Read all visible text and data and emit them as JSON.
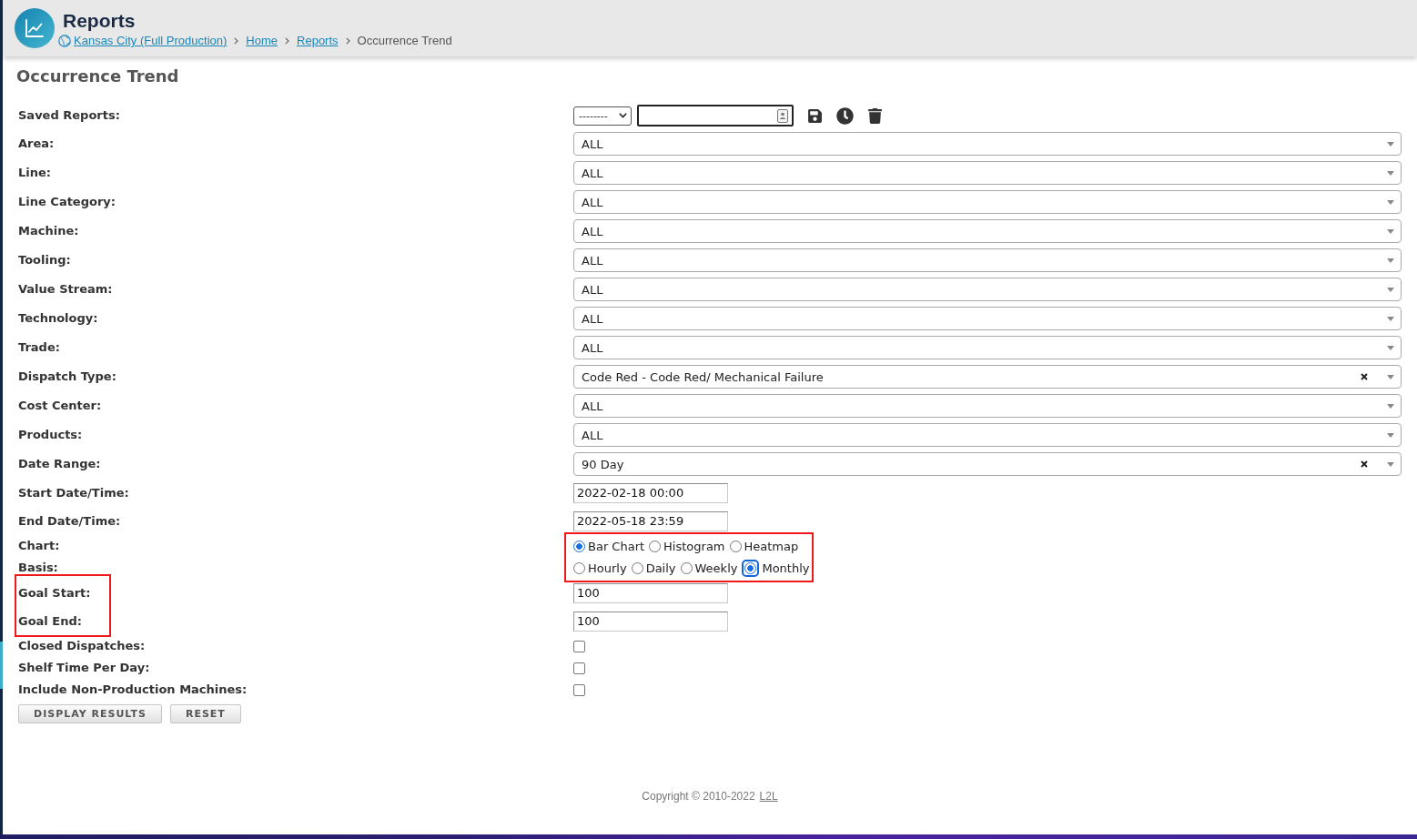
{
  "header": {
    "title": "Reports",
    "breadcrumb": [
      {
        "kind": "site",
        "label": "Kansas City (Full Production)"
      },
      {
        "kind": "link",
        "label": "Home"
      },
      {
        "kind": "link",
        "label": "Reports"
      },
      {
        "kind": "current",
        "label": "Occurrence Trend"
      }
    ]
  },
  "page_title": "Occurrence Trend",
  "form": {
    "rows": [
      {
        "kind": "saved",
        "label": "Saved Reports:",
        "dropdown": "--------",
        "label_framed": false,
        "control_framed": false
      },
      {
        "kind": "select",
        "label": "Area:",
        "value": "ALL",
        "clearable": false,
        "label_framed": false,
        "control_framed": false
      },
      {
        "kind": "select",
        "label": "Line:",
        "value": "ALL",
        "clearable": false,
        "label_framed": false,
        "control_framed": false
      },
      {
        "kind": "select",
        "label": "Line Category:",
        "value": "ALL",
        "clearable": false,
        "label_framed": false,
        "control_framed": false
      },
      {
        "kind": "select",
        "label": "Machine:",
        "value": "ALL",
        "clearable": false,
        "label_framed": false,
        "control_framed": false
      },
      {
        "kind": "select",
        "label": "Tooling:",
        "value": "ALL",
        "clearable": false,
        "label_framed": false,
        "control_framed": false
      },
      {
        "kind": "select",
        "label": "Value Stream:",
        "value": "ALL",
        "clearable": false,
        "label_framed": false,
        "control_framed": false
      },
      {
        "kind": "select",
        "label": "Technology:",
        "value": "ALL",
        "clearable": false,
        "label_framed": false,
        "control_framed": false
      },
      {
        "kind": "select",
        "label": "Trade:",
        "value": "ALL",
        "clearable": false,
        "label_framed": false,
        "control_framed": false
      },
      {
        "kind": "select",
        "label": "Dispatch Type:",
        "value": "Code Red - Code Red/ Mechanical Failure",
        "clearable": true,
        "label_framed": false,
        "control_framed": false
      },
      {
        "kind": "select",
        "label": "Cost Center:",
        "value": "ALL",
        "clearable": false,
        "label_framed": false,
        "control_framed": false
      },
      {
        "kind": "select",
        "label": "Products:",
        "value": "ALL",
        "clearable": false,
        "label_framed": false,
        "control_framed": false
      },
      {
        "kind": "select",
        "label": "Date Range:",
        "value": "90 Day",
        "clearable": true,
        "label_framed": false,
        "control_framed": false
      },
      {
        "kind": "text",
        "label": "Start Date/Time:",
        "value": "2022-02-18 00:00",
        "label_framed": false,
        "control_framed": false
      },
      {
        "kind": "text",
        "label": "End Date/Time:",
        "value": "2022-05-18 23:59",
        "label_framed": false,
        "control_framed": false
      },
      {
        "kind": "radio",
        "label": "Chart:",
        "options": [
          {
            "label": "Bar Chart",
            "selected": true,
            "focused": false
          },
          {
            "label": "Histogram",
            "selected": false,
            "focused": false
          },
          {
            "label": "Heatmap",
            "selected": false,
            "focused": false
          }
        ],
        "label_framed": false,
        "control_framed": true
      },
      {
        "kind": "radio",
        "label": "Basis:",
        "options": [
          {
            "label": "Hourly",
            "selected": false,
            "focused": false
          },
          {
            "label": "Daily",
            "selected": false,
            "focused": false
          },
          {
            "label": "Weekly",
            "selected": false,
            "focused": false
          },
          {
            "label": "Monthly",
            "selected": true,
            "focused": true
          }
        ],
        "label_framed": false,
        "control_framed": true
      },
      {
        "kind": "text",
        "label": "Goal Start:",
        "value": "100",
        "label_framed": true,
        "control_framed": false
      },
      {
        "kind": "text",
        "label": "Goal End:",
        "value": "100",
        "label_framed": true,
        "control_framed": false
      },
      {
        "kind": "checkbox",
        "label": "Closed Dispatches:",
        "checked": false,
        "label_framed": false,
        "control_framed": false
      },
      {
        "kind": "checkbox",
        "label": "Shelf Time Per Day:",
        "checked": false,
        "label_framed": false,
        "control_framed": false
      },
      {
        "kind": "checkbox",
        "label": "Include Non-Production Machines:",
        "checked": false,
        "label_framed": false,
        "control_framed": false
      }
    ]
  },
  "buttons": [
    {
      "label": "DISPLAY RESULTS"
    },
    {
      "label": "RESET"
    }
  ],
  "footer": {
    "text": "Copyright © 2010-2022",
    "link": "L2L"
  }
}
